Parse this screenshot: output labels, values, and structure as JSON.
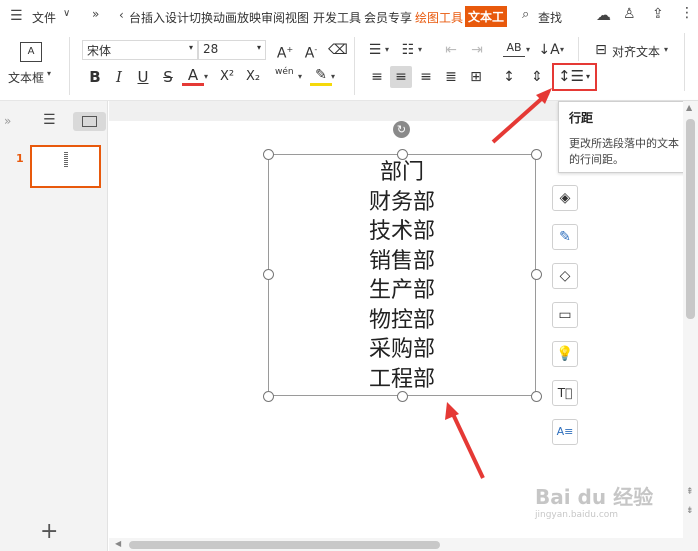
{
  "topbar": {
    "file_label": "文件",
    "tabs": [
      "台插入设计切换动画放映审阅视图",
      "开发工具",
      "会员专享",
      "绘图工具",
      "文本工"
    ],
    "search_label": "查找"
  },
  "ribbon": {
    "textbox_label": "文本框",
    "font_name": "宋体",
    "font_size": "28",
    "align_text_label": "对齐文本",
    "pinyin_label": "wén"
  },
  "tooltip": {
    "title": "行距",
    "body": "更改所选段落中的文本的行间距。"
  },
  "slide": {
    "text_lines": [
      "部门",
      "财务部",
      "技术部",
      "销售部",
      "生产部",
      "物控部",
      "采购部",
      "工程部"
    ]
  },
  "thumbnail": {
    "number": "1"
  },
  "watermark": {
    "text": "Bai du 经验",
    "sub": "jingyan.baidu.com"
  },
  "colors": {
    "accent": "#e8590c",
    "annotation_red": "#e53935"
  }
}
